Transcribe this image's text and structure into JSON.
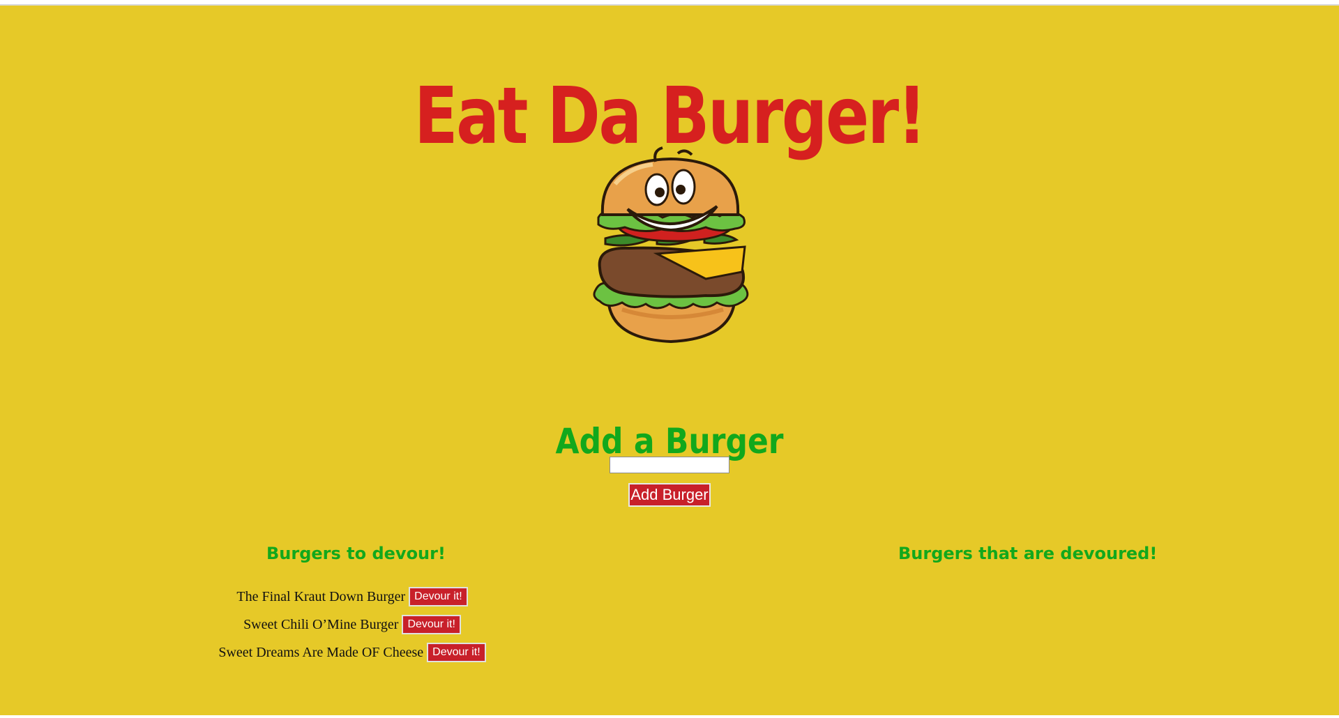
{
  "header": {
    "title": "Eat Da Burger!"
  },
  "form": {
    "heading": "Add a Burger",
    "input_value": "",
    "submit_label": "Add Burger"
  },
  "columns": {
    "to_devour_title": "Burgers to devour!",
    "devoured_title": "Burgers that are devoured!"
  },
  "burgers_to_devour": [
    {
      "name": "The Final Kraut Down Burger",
      "action": "Devour it!"
    },
    {
      "name": "Sweet Chili O’Mine Burger",
      "action": "Devour it!"
    },
    {
      "name": "Sweet Dreams Are Made OF Cheese",
      "action": "Devour it!"
    }
  ],
  "burgers_devoured": [],
  "colors": {
    "background": "#e6c928",
    "title_red": "#d6201f",
    "heading_green": "#12a81c",
    "button_red": "#c8202a"
  },
  "icons": {
    "mascot": "smiling-burger-icon"
  }
}
